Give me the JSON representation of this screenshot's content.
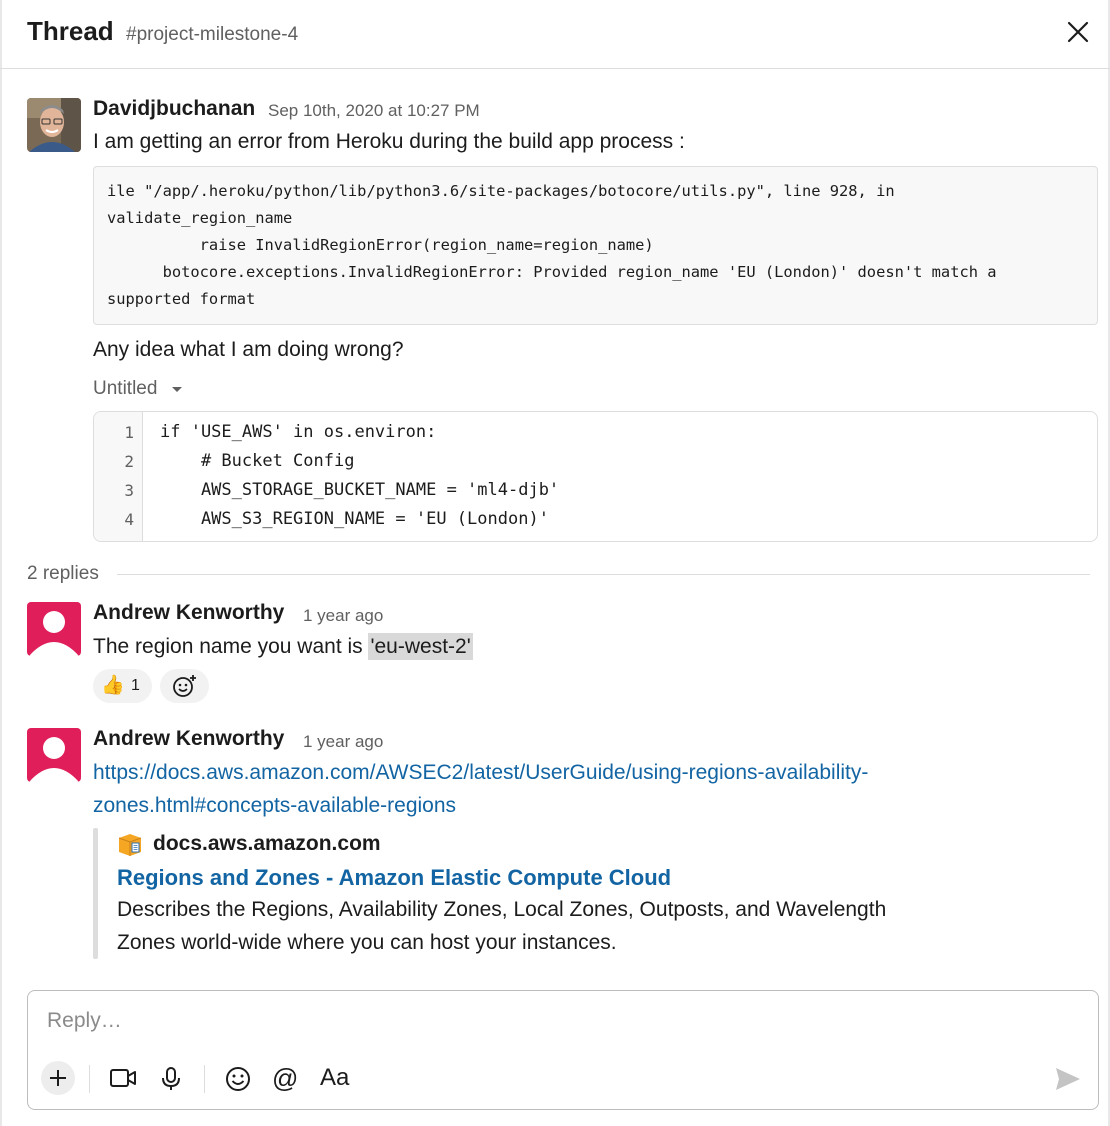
{
  "header": {
    "title": "Thread",
    "channel": "#project-milestone-4",
    "close_icon": "close-icon"
  },
  "root_message": {
    "author": "Davidjbuchanan",
    "timestamp": "Sep 10th, 2020 at 10:27 PM",
    "text": "I am getting an error from Heroku during the build app process :",
    "code_lines": [
      "ile \"/app/.heroku/python/lib/python3.6/site-packages/botocore/utils.py\", line 928, in",
      "validate_region_name",
      "          raise InvalidRegionError(region_name=region_name)",
      "      botocore.exceptions.InvalidRegionError: Provided region_name 'EU (London)' doesn't match a",
      "supported format"
    ],
    "followup": "Any idea what I am doing wrong?",
    "snippet": {
      "title": "Untitled",
      "lines": [
        {
          "num": "1",
          "code": "if 'USE_AWS' in os.environ:"
        },
        {
          "num": "2",
          "code": "    # Bucket Config"
        },
        {
          "num": "3",
          "code": "    AWS_STORAGE_BUCKET_NAME = 'ml4-djb'"
        },
        {
          "num": "4",
          "code": "    AWS_S3_REGION_NAME = 'EU (London)'"
        }
      ]
    }
  },
  "replies": {
    "count_label": "2 replies",
    "items": [
      {
        "author": "Andrew Kenworthy",
        "time": "1 year ago",
        "text_prefix": "The region name you want is ",
        "inline_code": "'eu-west-2'",
        "reactions": [
          {
            "emoji": "👍",
            "count": "1"
          }
        ]
      },
      {
        "author": "Andrew Kenworthy",
        "time": "1 year ago",
        "link_line1": "https://docs.aws.amazon.com/AWSEC2/latest/UserGuide/using-regions-availability-",
        "link_line2": "zones.html#concepts-available-regions",
        "unfurl": {
          "site": "docs.aws.amazon.com",
          "title": "Regions and Zones - Amazon Elastic Compute Cloud",
          "desc_line1": "Describes the Regions, Availability Zones, Local Zones, Outposts, and Wavelength",
          "desc_line2": "Zones world-wide where you can host your instances."
        }
      }
    ]
  },
  "composer": {
    "placeholder": "Reply…",
    "format_label": "Aa"
  },
  "colors": {
    "link": "#1264a3",
    "avatar_default": "#e01e5a",
    "muted": "#616061"
  }
}
